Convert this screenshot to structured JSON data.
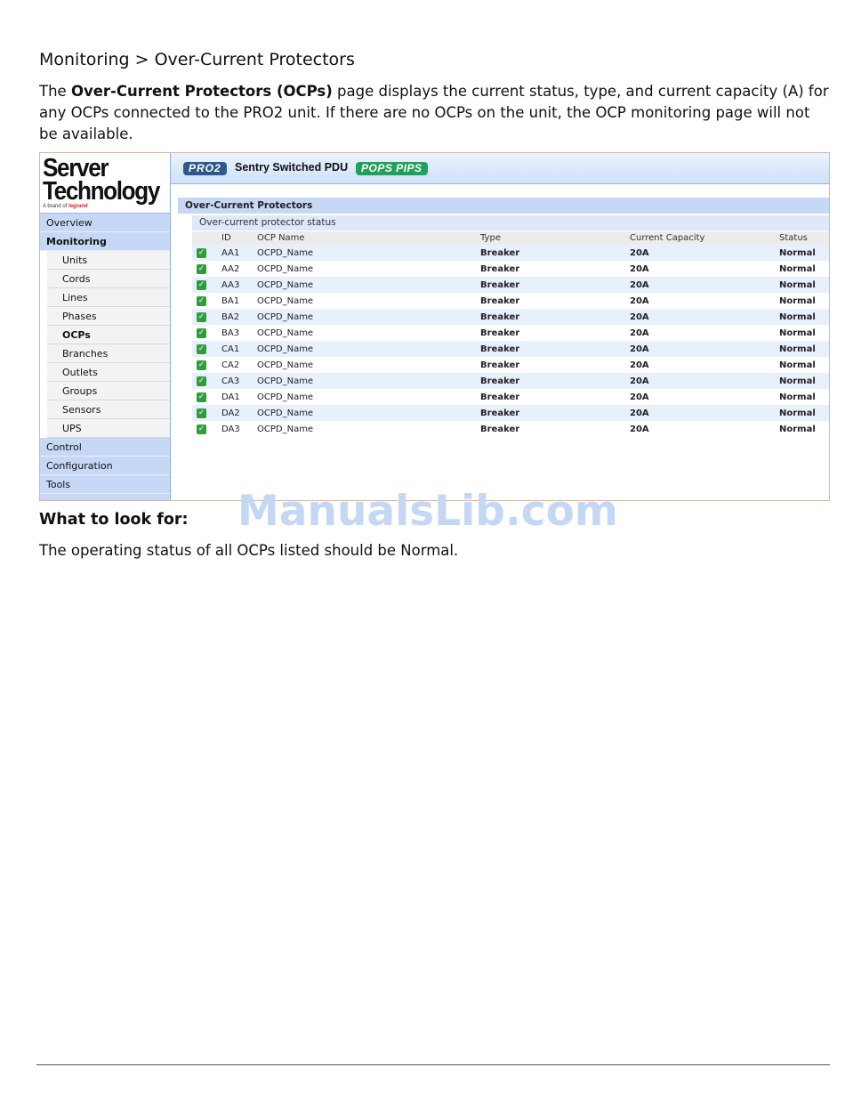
{
  "heading": "Monitoring > Over-Current Protectors",
  "intro": {
    "pre": "The ",
    "bold": "Over-Current Protectors (OCPs)",
    "post": " page displays the current status, type, and current capacity (A) for any OCPs connected to the PRO2 unit. If there are no OCPs on the unit, the OCP monitoring page will not be available."
  },
  "app": {
    "logo": {
      "line1": "Server",
      "line2": "Technology",
      "tag_pre": "A brand of ",
      "tag_brand": "legrand"
    },
    "banner": {
      "pro2": "PRO2",
      "title": "Sentry Switched PDU",
      "pops": "POPS PIPS"
    },
    "nav": {
      "overview": "Overview",
      "monitoring": "Monitoring",
      "sub": [
        "Units",
        "Cords",
        "Lines",
        "Phases",
        "OCPs",
        "Branches",
        "Outlets",
        "Groups",
        "Sensors",
        "UPS"
      ],
      "control": "Control",
      "configuration": "Configuration",
      "tools": "Tools"
    },
    "section_title": "Over-Current Protectors",
    "sub_title": "Over-current protector status",
    "columns": [
      "ID",
      "OCP Name",
      "Type",
      "Current Capacity",
      "Status"
    ],
    "rows": [
      {
        "id": "AA1",
        "name": "OCPD_Name",
        "type": "Breaker",
        "capacity": "20A",
        "status": "Normal"
      },
      {
        "id": "AA2",
        "name": "OCPD_Name",
        "type": "Breaker",
        "capacity": "20A",
        "status": "Normal"
      },
      {
        "id": "AA3",
        "name": "OCPD_Name",
        "type": "Breaker",
        "capacity": "20A",
        "status": "Normal"
      },
      {
        "id": "BA1",
        "name": "OCPD_Name",
        "type": "Breaker",
        "capacity": "20A",
        "status": "Normal"
      },
      {
        "id": "BA2",
        "name": "OCPD_Name",
        "type": "Breaker",
        "capacity": "20A",
        "status": "Normal"
      },
      {
        "id": "BA3",
        "name": "OCPD_Name",
        "type": "Breaker",
        "capacity": "20A",
        "status": "Normal"
      },
      {
        "id": "CA1",
        "name": "OCPD_Name",
        "type": "Breaker",
        "capacity": "20A",
        "status": "Normal"
      },
      {
        "id": "CA2",
        "name": "OCPD_Name",
        "type": "Breaker",
        "capacity": "20A",
        "status": "Normal"
      },
      {
        "id": "CA3",
        "name": "OCPD_Name",
        "type": "Breaker",
        "capacity": "20A",
        "status": "Normal"
      },
      {
        "id": "DA1",
        "name": "OCPD_Name",
        "type": "Breaker",
        "capacity": "20A",
        "status": "Normal"
      },
      {
        "id": "DA2",
        "name": "OCPD_Name",
        "type": "Breaker",
        "capacity": "20A",
        "status": "Normal"
      },
      {
        "id": "DA3",
        "name": "OCPD_Name",
        "type": "Breaker",
        "capacity": "20A",
        "status": "Normal"
      }
    ]
  },
  "watermark": "ManualsLib.com",
  "look_heading": "What to look for:",
  "look_text": "The operating status of all OCPs listed should be Normal."
}
